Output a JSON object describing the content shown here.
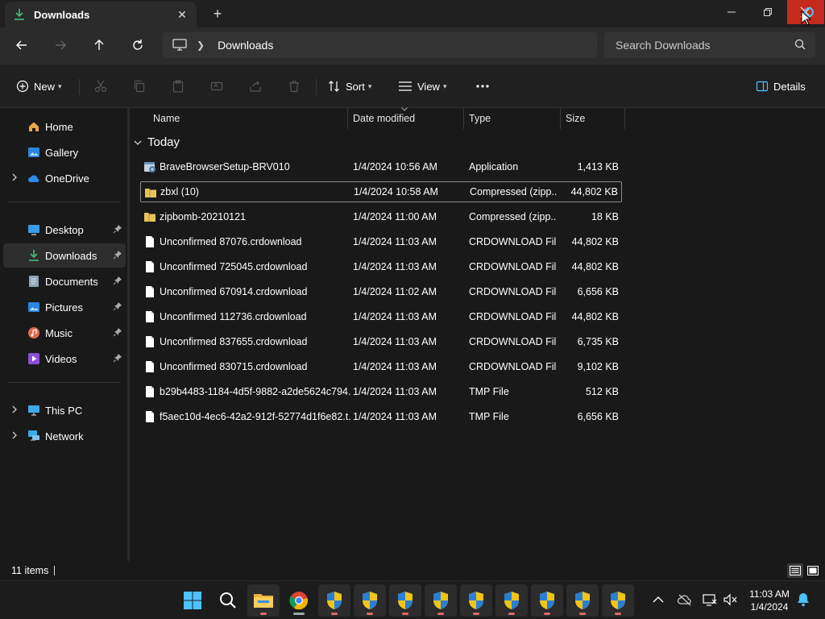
{
  "window": {
    "tab_title": "Downloads",
    "tab_icon": "download-icon",
    "controls": [
      "minimize-icon",
      "restore-icon",
      "close-icon"
    ]
  },
  "address": {
    "root_icon": "this-pc-icon",
    "path": "Downloads"
  },
  "search": {
    "placeholder": "Search Downloads"
  },
  "commands": {
    "new_label": "New",
    "sort_label": "Sort",
    "view_label": "View",
    "details_label": "Details"
  },
  "sidebar": {
    "quick": [
      {
        "label": "Home",
        "icon": "home-icon"
      },
      {
        "label": "Gallery",
        "icon": "gallery-icon"
      },
      {
        "label": "OneDrive",
        "icon": "onedrive-icon"
      }
    ],
    "pinned": [
      {
        "label": "Desktop",
        "icon": "desktop-icon"
      },
      {
        "label": "Downloads",
        "icon": "download-icon",
        "active": true
      },
      {
        "label": "Documents",
        "icon": "documents-icon"
      },
      {
        "label": "Pictures",
        "icon": "pictures-icon"
      },
      {
        "label": "Music",
        "icon": "music-icon"
      },
      {
        "label": "Videos",
        "icon": "videos-icon"
      }
    ],
    "devices": [
      {
        "label": "This PC",
        "icon": "this-pc-icon"
      },
      {
        "label": "Network",
        "icon": "network-icon"
      }
    ]
  },
  "columns": {
    "name": "Name",
    "date": "Date modified",
    "type": "Type",
    "size": "Size"
  },
  "group": {
    "label": "Today"
  },
  "files": [
    {
      "name": "BraveBrowserSetup-BRV010",
      "date": "1/4/2024 10:56 AM",
      "type": "Application",
      "size": "1,413 KB",
      "icon": "installer-icon"
    },
    {
      "name": "zbxl (10)",
      "date": "1/4/2024 10:58 AM",
      "type": "Compressed (zipp...",
      "size": "44,802 KB",
      "icon": "zip-folder-icon",
      "selected": true
    },
    {
      "name": "zipbomb-20210121",
      "date": "1/4/2024 11:00 AM",
      "type": "Compressed (zipp...",
      "size": "18 KB",
      "icon": "zip-folder-icon"
    },
    {
      "name": "Unconfirmed 87076.crdownload",
      "date": "1/4/2024 11:03 AM",
      "type": "CRDOWNLOAD File",
      "size": "44,802 KB",
      "icon": "file-icon"
    },
    {
      "name": "Unconfirmed 725045.crdownload",
      "date": "1/4/2024 11:03 AM",
      "type": "CRDOWNLOAD File",
      "size": "44,802 KB",
      "icon": "file-icon"
    },
    {
      "name": "Unconfirmed 670914.crdownload",
      "date": "1/4/2024 11:02 AM",
      "type": "CRDOWNLOAD File",
      "size": "6,656 KB",
      "icon": "file-icon"
    },
    {
      "name": "Unconfirmed 112736.crdownload",
      "date": "1/4/2024 11:03 AM",
      "type": "CRDOWNLOAD File",
      "size": "44,802 KB",
      "icon": "file-icon"
    },
    {
      "name": "Unconfirmed 837655.crdownload",
      "date": "1/4/2024 11:03 AM",
      "type": "CRDOWNLOAD File",
      "size": "6,735 KB",
      "icon": "file-icon"
    },
    {
      "name": "Unconfirmed 830715.crdownload",
      "date": "1/4/2024 11:03 AM",
      "type": "CRDOWNLOAD File",
      "size": "9,102 KB",
      "icon": "file-icon"
    },
    {
      "name": "b29b4483-1184-4d5f-9882-a2de5624c794....",
      "date": "1/4/2024 11:03 AM",
      "type": "TMP File",
      "size": "512 KB",
      "icon": "file-icon"
    },
    {
      "name": "f5aec10d-4ec6-42a2-912f-52774d1f6e82.t...",
      "date": "1/4/2024 11:03 AM",
      "type": "TMP File",
      "size": "6,656 KB",
      "icon": "file-icon"
    }
  ],
  "status": {
    "count": "11 items"
  },
  "taskbar": {
    "apps": [
      "start-icon",
      "search-icon",
      "file-explorer-icon",
      "chrome-icon",
      "uac-shield-icon",
      "uac-shield-icon",
      "uac-shield-icon",
      "uac-shield-icon",
      "uac-shield-icon",
      "uac-shield-icon",
      "uac-shield-icon",
      "uac-shield-icon",
      "uac-shield-icon"
    ],
    "time": "11:03 AM",
    "date": "1/4/2024"
  },
  "colors": {
    "accent": "#4cc2ff",
    "close_hover": "#c42b1c",
    "folder": "#e8c25a"
  }
}
